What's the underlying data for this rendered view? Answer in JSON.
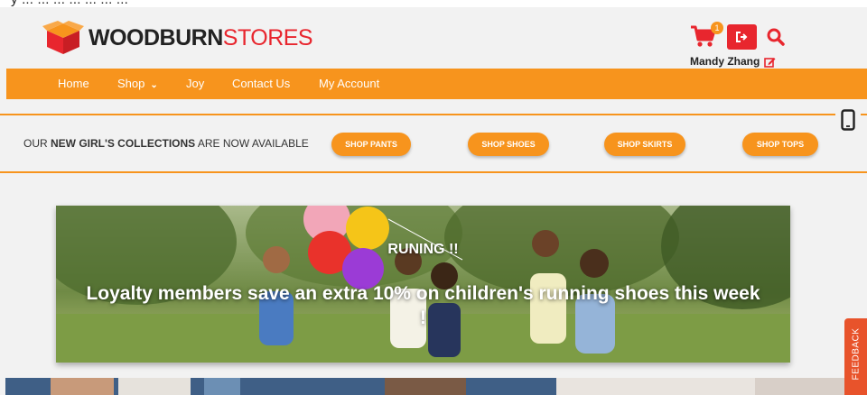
{
  "top_strip_text": "y ... ... ... ... ... ... ...",
  "header": {
    "brand_bold": "WOODBURN",
    "brand_light": "STORES",
    "cart_count": "1",
    "user_name": "Mandy Zhang",
    "icons": {
      "cart": "cart-icon",
      "logout": "logout-icon",
      "search": "search-icon",
      "edit": "edit-icon"
    }
  },
  "nav": {
    "items": [
      {
        "label": "Home"
      },
      {
        "label": "Shop"
      },
      {
        "label": "Joy"
      },
      {
        "label": "Contact Us"
      },
      {
        "label": "My Account"
      }
    ]
  },
  "promo": {
    "prefix": "OUR ",
    "highlight": "NEW GIRL'S COLLECTIONS",
    "suffix": " ARE NOW AVAILABLE",
    "buttons": [
      "SHOP PANTS",
      "SHOP SHOES",
      "SHOP SKIRTS",
      "SHOP TOPS"
    ]
  },
  "hero": {
    "title": "RUNING !!",
    "description": "Loyalty members save an extra 10% on children's running shoes this week !"
  },
  "feedback_label": "FEEDBACK",
  "colors": {
    "accent": "#f7941d",
    "brand_red": "#e8262e",
    "feedback": "#e8532b"
  }
}
